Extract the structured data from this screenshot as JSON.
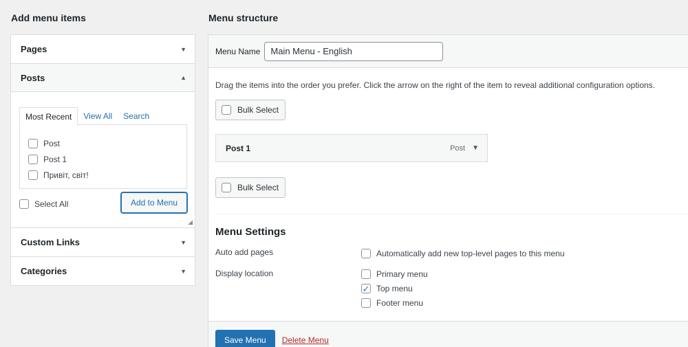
{
  "left": {
    "heading": "Add menu items",
    "sections": {
      "pages": "Pages",
      "posts": "Posts",
      "custom_links": "Custom Links",
      "categories": "Categories"
    },
    "tabs": [
      "Most Recent",
      "View All",
      "Search"
    ],
    "posts_list": [
      "Post",
      "Post 1",
      "Привіт, світ!"
    ],
    "select_all": "Select All",
    "add_to_menu": "Add to Menu"
  },
  "right": {
    "heading": "Menu structure",
    "menu_name_label": "Menu Name",
    "menu_name_value": "Main Menu - English",
    "instructions": "Drag the items into the order you prefer. Click the arrow on the right of the item to reveal additional configuration options.",
    "bulk_select": "Bulk Select",
    "menu_item": {
      "title": "Post 1",
      "type": "Post"
    },
    "settings": {
      "title": "Menu Settings",
      "auto_add_label": "Auto add pages",
      "auto_add_option": "Automatically add new top-level pages to this menu",
      "display_location_label": "Display location",
      "locations": [
        {
          "label": "Primary menu",
          "checked": false
        },
        {
          "label": "Top menu",
          "checked": true
        },
        {
          "label": "Footer menu",
          "checked": false
        }
      ]
    },
    "save_menu": "Save Menu",
    "delete_menu": "Delete Menu"
  },
  "colors": {
    "accent": "#2271b1",
    "danger": "#b32d2e",
    "background": "#f0f0f1"
  },
  "icons": {
    "collapsed": "chevron-down-icon",
    "expanded": "chevron-up-icon",
    "item_toggle": "chevron-down-icon"
  }
}
